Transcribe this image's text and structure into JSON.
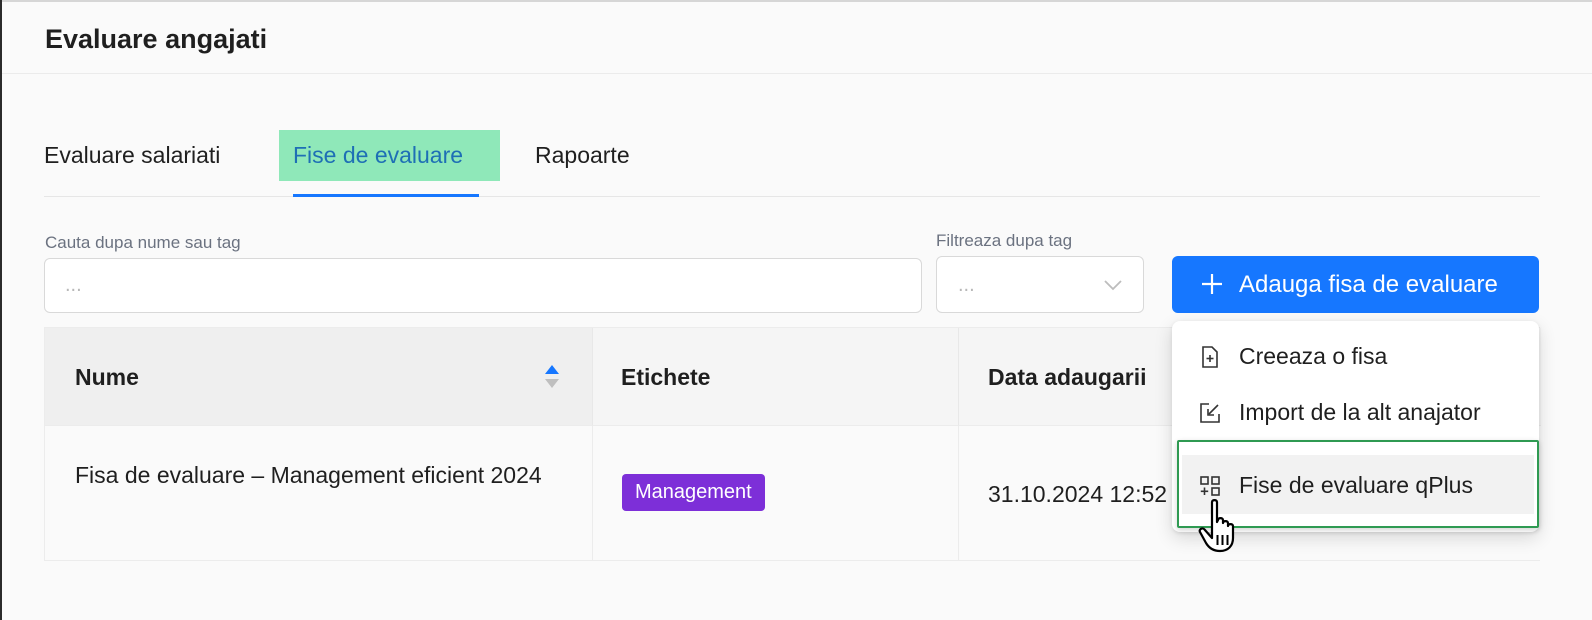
{
  "header": {
    "title": "Evaluare angajati"
  },
  "tabs": [
    {
      "label": "Evaluare salariati",
      "active": false
    },
    {
      "label": "Fise de evaluare",
      "active": true
    },
    {
      "label": "Rapoarte",
      "active": false
    }
  ],
  "filters": {
    "search_label": "Cauta dupa nume sau tag",
    "search_placeholder": "...",
    "tag_label": "Filtreaza dupa tag",
    "tag_placeholder": "..."
  },
  "add_button": {
    "label": "Adauga fisa de evaluare",
    "icon": "plus-icon"
  },
  "table": {
    "columns": [
      "Nume",
      "Etichete",
      "Data adaugarii"
    ],
    "rows": [
      {
        "name": "Fisa de evaluare – Management eficient 2024",
        "tag": "Management",
        "date": "31.10.2024 12:52"
      }
    ]
  },
  "dropdown": {
    "items": [
      {
        "label": "Creeaza o fisa",
        "icon": "file-add-icon"
      },
      {
        "label": "Import de la alt anajator",
        "icon": "import-icon"
      },
      {
        "label": "Fise de evaluare qPlus",
        "icon": "grid-add-icon"
      }
    ]
  },
  "colors": {
    "primary": "#1677ff",
    "active_tab_bg": "#8fe8b9",
    "tag_bg": "#7d2fd8",
    "highlight_border": "#2f9a52"
  }
}
